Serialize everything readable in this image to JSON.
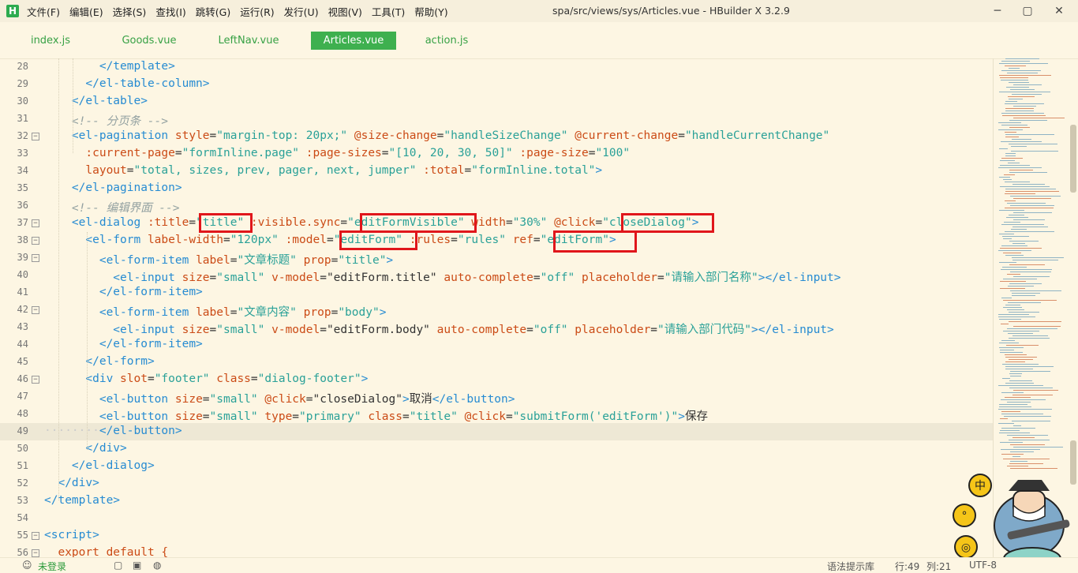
{
  "window": {
    "title": "spa/src/views/sys/Articles.vue - HBuilder X 3.2.9",
    "logo": "H",
    "controls": [
      "─",
      "▢",
      "✕"
    ]
  },
  "menu": [
    "文件(F)",
    "编辑(E)",
    "选择(S)",
    "查找(I)",
    "跳转(G)",
    "运行(R)",
    "发行(U)",
    "视图(V)",
    "工具(T)",
    "帮助(Y)"
  ],
  "tabs": [
    {
      "label": "index.js",
      "active": false
    },
    {
      "label": "Goods.vue",
      "active": false
    },
    {
      "label": "LeftNav.vue",
      "active": false
    },
    {
      "label": "Articles.vue",
      "active": true
    },
    {
      "label": "action.js",
      "active": false
    }
  ],
  "editor": {
    "current_line": "49",
    "lines": [
      {
        "n": "28",
        "fold": "",
        "seg": [
          [
            "tg",
            "        </template>"
          ]
        ]
      },
      {
        "n": "29",
        "fold": "",
        "seg": [
          [
            "tg",
            "      </el-table-column>"
          ]
        ]
      },
      {
        "n": "30",
        "fold": "",
        "seg": [
          [
            "tg",
            "    </el-table>"
          ]
        ]
      },
      {
        "n": "31",
        "fold": "",
        "seg": [
          [
            "cm",
            "    <!-- 分页条 -->"
          ]
        ]
      },
      {
        "n": "32",
        "fold": "⊟",
        "seg": [
          [
            "tg",
            "    <el-pagination "
          ],
          [
            "at",
            "style"
          ],
          [
            "tx",
            "="
          ],
          [
            "st",
            "\"margin-top: 20px;\""
          ],
          [
            "tx",
            " "
          ],
          [
            "at",
            "@size-change"
          ],
          [
            "tx",
            "="
          ],
          [
            "st",
            "\"handleSizeChange\""
          ],
          [
            "tx",
            " "
          ],
          [
            "at",
            "@current-change"
          ],
          [
            "tx",
            "="
          ],
          [
            "st",
            "\"handleCurrentChange\""
          ]
        ]
      },
      {
        "n": "33",
        "fold": "",
        "seg": [
          [
            "at",
            "      :current-page"
          ],
          [
            "tx",
            "="
          ],
          [
            "st",
            "\"formInline.page\""
          ],
          [
            "tx",
            " "
          ],
          [
            "at",
            ":page-sizes"
          ],
          [
            "tx",
            "="
          ],
          [
            "st",
            "\"[10, 20, 30, 50]\""
          ],
          [
            "tx",
            " "
          ],
          [
            "at",
            ":page-size"
          ],
          [
            "tx",
            "="
          ],
          [
            "st",
            "\"100\""
          ]
        ]
      },
      {
        "n": "34",
        "fold": "",
        "seg": [
          [
            "at",
            "      layout"
          ],
          [
            "tx",
            "="
          ],
          [
            "st",
            "\"total, sizes, prev, pager, next, jumper\""
          ],
          [
            "tx",
            " "
          ],
          [
            "at",
            ":total"
          ],
          [
            "tx",
            "="
          ],
          [
            "st",
            "\"formInline.total\""
          ],
          [
            "tg",
            ">"
          ]
        ]
      },
      {
        "n": "35",
        "fold": "",
        "seg": [
          [
            "tg",
            "    </el-pagination>"
          ]
        ]
      },
      {
        "n": "36",
        "fold": "",
        "seg": [
          [
            "cm",
            "    <!-- 编辑界面 -->"
          ]
        ]
      },
      {
        "n": "37",
        "fold": "⊟",
        "seg": [
          [
            "tg",
            "    <el-dialog "
          ],
          [
            "at",
            ":title"
          ],
          [
            "tx",
            "="
          ],
          [
            "st",
            "\"title\""
          ],
          [
            "tx",
            " "
          ],
          [
            "at",
            ":visible.sync"
          ],
          [
            "tx",
            "="
          ],
          [
            "st",
            "\"editFormVisible\""
          ],
          [
            "tx",
            " "
          ],
          [
            "at",
            "width"
          ],
          [
            "tx",
            "="
          ],
          [
            "st",
            "\"30%\""
          ],
          [
            "tx",
            " "
          ],
          [
            "at",
            "@click"
          ],
          [
            "tx",
            "="
          ],
          [
            "st",
            "\"closeDialog\""
          ],
          [
            "tg",
            ">"
          ]
        ]
      },
      {
        "n": "38",
        "fold": "⊟",
        "seg": [
          [
            "tg",
            "      <el-form "
          ],
          [
            "at",
            "label-width"
          ],
          [
            "tx",
            "="
          ],
          [
            "st",
            "\"120px\""
          ],
          [
            "tx",
            " "
          ],
          [
            "at",
            ":model"
          ],
          [
            "tx",
            "="
          ],
          [
            "st",
            "\"editForm\""
          ],
          [
            "tx",
            " "
          ],
          [
            "at",
            ":rules"
          ],
          [
            "tx",
            "="
          ],
          [
            "st",
            "\"rules\""
          ],
          [
            "tx",
            " "
          ],
          [
            "at",
            "ref"
          ],
          [
            "tx",
            "="
          ],
          [
            "st",
            "\"editForm\""
          ],
          [
            "tg",
            ">"
          ]
        ]
      },
      {
        "n": "39",
        "fold": "⊟",
        "seg": [
          [
            "tg",
            "        <el-form-item "
          ],
          [
            "at",
            "label"
          ],
          [
            "tx",
            "="
          ],
          [
            "st",
            "\"文章标题\""
          ],
          [
            "tx",
            " "
          ],
          [
            "at",
            "prop"
          ],
          [
            "tx",
            "="
          ],
          [
            "st",
            "\"title\""
          ],
          [
            "tg",
            ">"
          ]
        ]
      },
      {
        "n": "40",
        "fold": "",
        "seg": [
          [
            "tg",
            "          <el-input "
          ],
          [
            "at",
            "size"
          ],
          [
            "tx",
            "="
          ],
          [
            "st",
            "\"small\""
          ],
          [
            "tx",
            " "
          ],
          [
            "at",
            "v-model"
          ],
          [
            "tx",
            "="
          ],
          [
            "tx",
            "\"editForm.title\""
          ],
          [
            "tx",
            " "
          ],
          [
            "at",
            "auto-complete"
          ],
          [
            "tx",
            "="
          ],
          [
            "st",
            "\"off\""
          ],
          [
            "tx",
            " "
          ],
          [
            "at",
            "placeholder"
          ],
          [
            "tx",
            "="
          ],
          [
            "st",
            "\"请输入部门名称\""
          ],
          [
            "tg",
            "></el-input>"
          ]
        ]
      },
      {
        "n": "41",
        "fold": "",
        "seg": [
          [
            "tg",
            "        </el-form-item>"
          ]
        ]
      },
      {
        "n": "42",
        "fold": "⊟",
        "seg": [
          [
            "tg",
            "        <el-form-item "
          ],
          [
            "at",
            "label"
          ],
          [
            "tx",
            "="
          ],
          [
            "st",
            "\"文章内容\""
          ],
          [
            "tx",
            " "
          ],
          [
            "at",
            "prop"
          ],
          [
            "tx",
            "="
          ],
          [
            "st",
            "\"body\""
          ],
          [
            "tg",
            ">"
          ]
        ]
      },
      {
        "n": "43",
        "fold": "",
        "seg": [
          [
            "tg",
            "          <el-input "
          ],
          [
            "at",
            "size"
          ],
          [
            "tx",
            "="
          ],
          [
            "st",
            "\"small\""
          ],
          [
            "tx",
            " "
          ],
          [
            "at",
            "v-model"
          ],
          [
            "tx",
            "="
          ],
          [
            "tx",
            "\"editForm.body\""
          ],
          [
            "tx",
            " "
          ],
          [
            "at",
            "auto-complete"
          ],
          [
            "tx",
            "="
          ],
          [
            "st",
            "\"off\""
          ],
          [
            "tx",
            " "
          ],
          [
            "at",
            "placeholder"
          ],
          [
            "tx",
            "="
          ],
          [
            "st",
            "\"请输入部门代码\""
          ],
          [
            "tg",
            "></el-input>"
          ]
        ]
      },
      {
        "n": "44",
        "fold": "",
        "seg": [
          [
            "tg",
            "        </el-form-item>"
          ]
        ]
      },
      {
        "n": "45",
        "fold": "",
        "seg": [
          [
            "tg",
            "      </el-form>"
          ]
        ]
      },
      {
        "n": "46",
        "fold": "⊟",
        "seg": [
          [
            "tg",
            "      <div "
          ],
          [
            "at",
            "slot"
          ],
          [
            "tx",
            "="
          ],
          [
            "st",
            "\"footer\""
          ],
          [
            "tx",
            " "
          ],
          [
            "at",
            "class"
          ],
          [
            "tx",
            "="
          ],
          [
            "st",
            "\"dialog-footer\""
          ],
          [
            "tg",
            ">"
          ]
        ]
      },
      {
        "n": "47",
        "fold": "",
        "seg": [
          [
            "tg",
            "        <el-button "
          ],
          [
            "at",
            "size"
          ],
          [
            "tx",
            "="
          ],
          [
            "st",
            "\"small\""
          ],
          [
            "tx",
            " "
          ],
          [
            "at",
            "@click"
          ],
          [
            "tx",
            "="
          ],
          [
            "tx",
            "\"closeDialog\""
          ],
          [
            "tg",
            ">"
          ],
          [
            "tx",
            "取消"
          ],
          [
            "tg",
            "</el-button>"
          ]
        ]
      },
      {
        "n": "48",
        "fold": "",
        "seg": [
          [
            "tg",
            "        <el-button "
          ],
          [
            "at",
            "size"
          ],
          [
            "tx",
            "="
          ],
          [
            "st",
            "\"small\""
          ],
          [
            "tx",
            " "
          ],
          [
            "at",
            "type"
          ],
          [
            "tx",
            "="
          ],
          [
            "st",
            "\"primary\""
          ],
          [
            "tx",
            " "
          ],
          [
            "at",
            "class"
          ],
          [
            "tx",
            "="
          ],
          [
            "st",
            "\"title\""
          ],
          [
            "tx",
            " "
          ],
          [
            "at",
            "@click"
          ],
          [
            "tx",
            "="
          ],
          [
            "st",
            "\"submitForm('editForm')\""
          ],
          [
            "tg",
            ">"
          ],
          [
            "tx",
            "保存"
          ]
        ]
      },
      {
        "n": "49",
        "fold": "",
        "seg": [
          [
            "dots",
            "········"
          ],
          [
            "tg",
            "</el-button>"
          ]
        ]
      },
      {
        "n": "50",
        "fold": "",
        "seg": [
          [
            "tg",
            "      </div>"
          ]
        ]
      },
      {
        "n": "51",
        "fold": "",
        "seg": [
          [
            "tg",
            "    </el-dialog>"
          ]
        ]
      },
      {
        "n": "52",
        "fold": "",
        "seg": [
          [
            "tg",
            "  </div>"
          ]
        ]
      },
      {
        "n": "53",
        "fold": "",
        "seg": [
          [
            "tg",
            "</template>"
          ]
        ]
      },
      {
        "n": "54",
        "fold": "",
        "seg": [
          [
            "tx",
            ""
          ]
        ]
      },
      {
        "n": "55",
        "fold": "⊟",
        "seg": [
          [
            "tg",
            "<script>"
          ]
        ]
      },
      {
        "n": "56",
        "fold": "⊟",
        "seg": [
          [
            "at",
            "  export default {"
          ]
        ]
      }
    ]
  },
  "mascot_badges": [
    "中",
    "°",
    "◎"
  ],
  "status": {
    "login": "未登录",
    "hint": "语法提示库",
    "row": "行:49",
    "col": "列:21",
    "encoding": "UTF-8"
  },
  "colors": {
    "accent": "#3eb04f",
    "highlight_box": "#e0161b",
    "editor_bg": "#fdf6e3"
  }
}
